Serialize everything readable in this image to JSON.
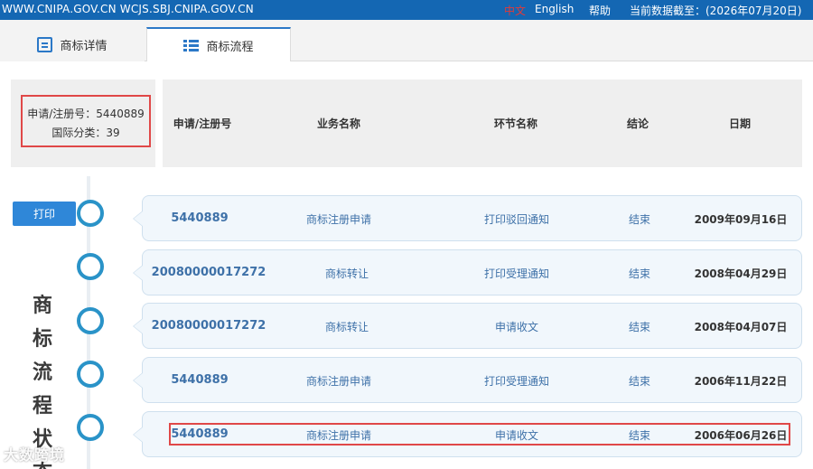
{
  "topbar": {
    "sites": "WWW.CNIPA.GOV.CN WCJS.SBJ.CNIPA.GOV.CN",
    "lang_zh": "中文",
    "lang_en": "English",
    "help": "帮助",
    "data_as_of": "当前数据截至：(2026年07月20日)"
  },
  "tabs": [
    {
      "label": "商标详情",
      "icon": "document-icon"
    },
    {
      "label": "商标流程",
      "icon": "list-icon"
    }
  ],
  "info": {
    "reg_number": "申请/注册号：5440889",
    "intl_class": "国际分类：39"
  },
  "columns": [
    "申请/注册号",
    "业务名称",
    "环节名称",
    "结论",
    "日期"
  ],
  "print_label": "打印",
  "side_title": [
    "商",
    "标",
    "流",
    "程",
    "状",
    "态"
  ],
  "rows": [
    {
      "reg": "5440889",
      "business": "商标注册申请",
      "node": "打印驳回通知",
      "result": "结束",
      "date": "2009年09月16日"
    },
    {
      "reg": "20080000017272",
      "business": "商标转让",
      "node": "打印受理通知",
      "result": "结束",
      "date": "2008年04月29日"
    },
    {
      "reg": "20080000017272",
      "business": "商标转让",
      "node": "申请收文",
      "result": "结束",
      "date": "2008年04月07日"
    },
    {
      "reg": "5440889",
      "business": "商标注册申请",
      "node": "打印受理通知",
      "result": "结束",
      "date": "2006年11月22日"
    },
    {
      "reg": "5440889",
      "business": "商标注册申请",
      "node": "申请收文",
      "result": "结束",
      "date": "2006年06月26日"
    }
  ],
  "watermark": "大数跨境",
  "colors": {
    "topbar": "#1467b3",
    "accent": "#2a93c8",
    "highlight": "#e04848"
  }
}
